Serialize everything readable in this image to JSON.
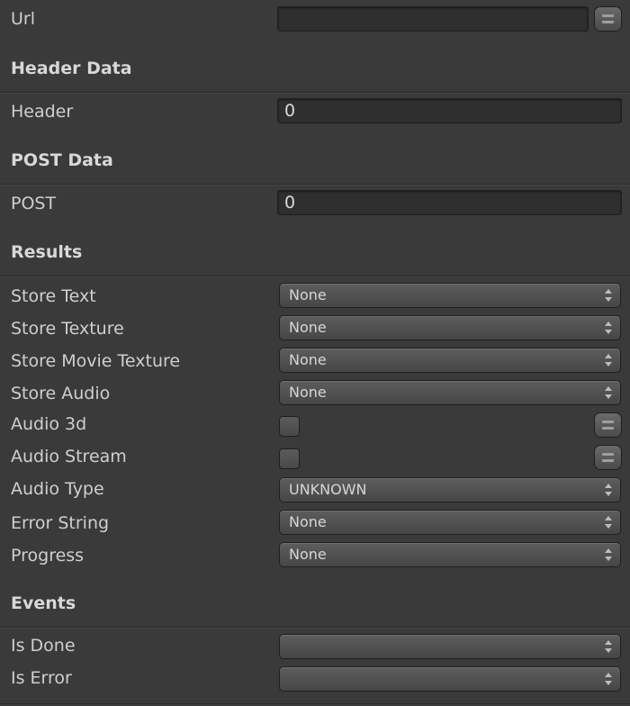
{
  "fields": {
    "url": {
      "label": "Url",
      "value": ""
    },
    "header": {
      "label": "Header",
      "value": "0"
    },
    "post": {
      "label": "POST",
      "value": "0"
    }
  },
  "sections": {
    "header_data": "Header Data",
    "post_data": "POST Data",
    "results": "Results",
    "events": "Events"
  },
  "results": {
    "store_text": {
      "label": "Store Text",
      "value": "None"
    },
    "store_texture": {
      "label": "Store Texture",
      "value": "None"
    },
    "store_movie_texture": {
      "label": "Store Movie Texture",
      "value": "None"
    },
    "store_audio": {
      "label": "Store Audio",
      "value": "None"
    },
    "audio_3d": {
      "label": "Audio 3d",
      "checked": false
    },
    "audio_stream": {
      "label": "Audio Stream",
      "checked": false
    },
    "audio_type": {
      "label": "Audio Type",
      "value": "UNKNOWN"
    },
    "error_string": {
      "label": "Error String",
      "value": "None"
    },
    "progress": {
      "label": "Progress",
      "value": "None"
    }
  },
  "events": {
    "is_done": {
      "label": "Is Done",
      "value": ""
    },
    "is_error": {
      "label": "Is Error",
      "value": ""
    }
  }
}
